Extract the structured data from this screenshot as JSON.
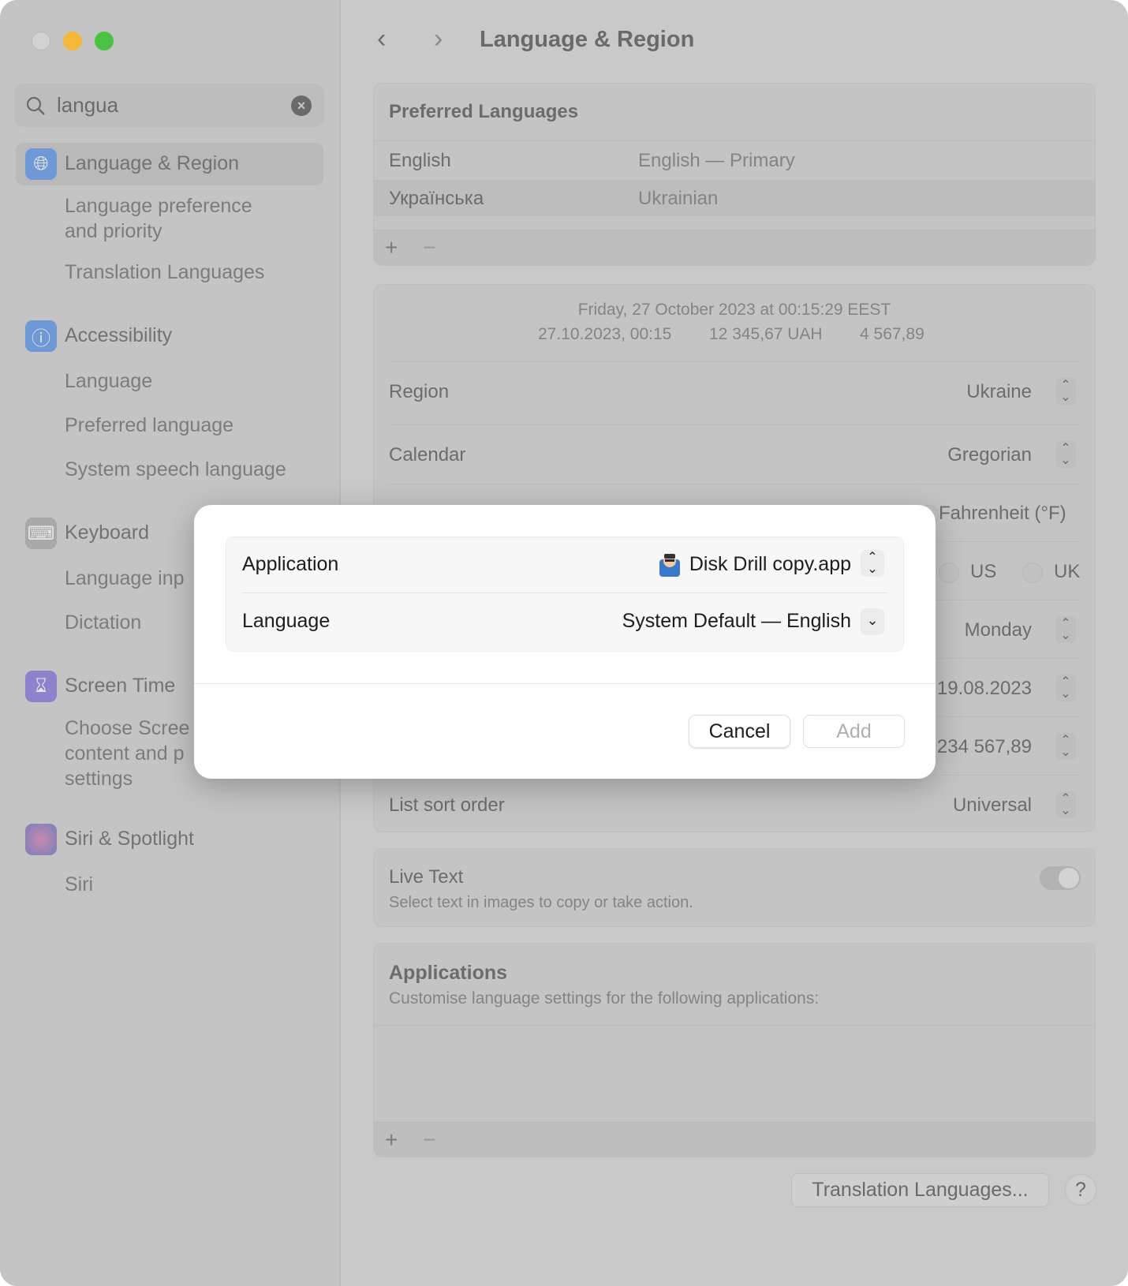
{
  "window": {
    "title": "Language & Region",
    "traffic_lights": {
      "close": "#d2d2d2",
      "minimize": "#f7b73b",
      "zoom": "#4ac140"
    }
  },
  "sidebar": {
    "search": {
      "value": "langua",
      "clear_icon": "x-circle-icon"
    },
    "sections": [
      {
        "label": "Language & Region",
        "icon": "globe-icon",
        "icon_color": "#6f98d6",
        "items": [
          "Language preference\nand priority",
          "Translation Languages"
        ]
      },
      {
        "label": "Accessibility",
        "icon": "accessibility-icon",
        "icon_color": "#6f98d6",
        "items": [
          "Language",
          "Preferred language",
          "System speech language"
        ]
      },
      {
        "label": "Keyboard",
        "icon": "keyboard-icon",
        "icon_color": "#a9a9a9",
        "items": [
          "Language inp",
          "Dictation"
        ]
      },
      {
        "label": "Screen Time",
        "icon": "hourglass-icon",
        "icon_color": "#8f82cc",
        "items": [
          "Choose Scree\ncontent and p\nsettings"
        ]
      },
      {
        "label": "Siri & Spotlight",
        "icon": "siri-icon",
        "icon_color": "#a07bb3",
        "items": [
          "Siri"
        ]
      }
    ]
  },
  "preferred_languages": {
    "title": "Preferred Languages",
    "rows": [
      {
        "name": "English",
        "detail": "English — Primary"
      },
      {
        "name": "Українська",
        "detail": "Ukrainian"
      }
    ],
    "add": "+",
    "remove": "−"
  },
  "region_card": {
    "preview_line1": "Friday, 27 October 2023 at 00:15:29 EEST",
    "preview_line2": [
      "27.10.2023, 00:15",
      "12 345,67 UAH",
      "4 567,89"
    ],
    "rows": [
      {
        "label": "Region",
        "value": "Ukraine"
      },
      {
        "label": "Calendar",
        "value": "Gregorian"
      },
      {
        "value": "Fahrenheit (°F)"
      },
      {
        "options": [
          "US",
          "UK"
        ]
      },
      {
        "value": "Monday"
      },
      {
        "value": "19.08.2023"
      },
      {
        "value": "234 567,89"
      },
      {
        "label": "List sort order",
        "value": "Universal"
      }
    ]
  },
  "live_text": {
    "title": "Live Text",
    "subtitle": "Select text in images to copy or take action.",
    "enabled": false
  },
  "applications": {
    "title": "Applications",
    "subtitle": "Customise language settings for the following applications:",
    "add": "+",
    "remove": "−"
  },
  "footer": {
    "translation_button": "Translation Languages...",
    "help": "?"
  },
  "dialog": {
    "application_label": "Application",
    "application_value": "Disk Drill copy.app",
    "language_label": "Language",
    "language_value": "System Default — English",
    "cancel": "Cancel",
    "add": "Add"
  }
}
